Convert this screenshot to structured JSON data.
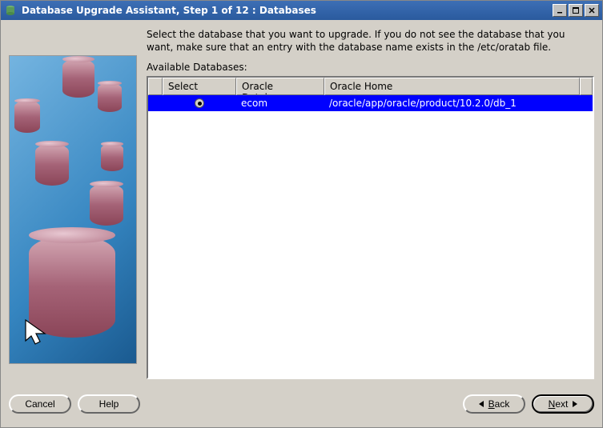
{
  "window": {
    "title": "Database Upgrade Assistant, Step 1 of 12 : Databases"
  },
  "instruction": "Select the database that you want to upgrade. If you do not see the database that you want, make sure that an entry with the database name exists in the /etc/oratab file.",
  "avail_label": "Available Databases:",
  "columns": {
    "select": "Select",
    "oracle_db": "Oracle Database",
    "oracle_home": "Oracle Home"
  },
  "rows": [
    {
      "selected": true,
      "database": "ecom",
      "home": "/oracle/app/oracle/product/10.2.0/db_1"
    }
  ],
  "buttons": {
    "cancel": "Cancel",
    "help": "Help",
    "back": "Back",
    "next": "Next"
  }
}
